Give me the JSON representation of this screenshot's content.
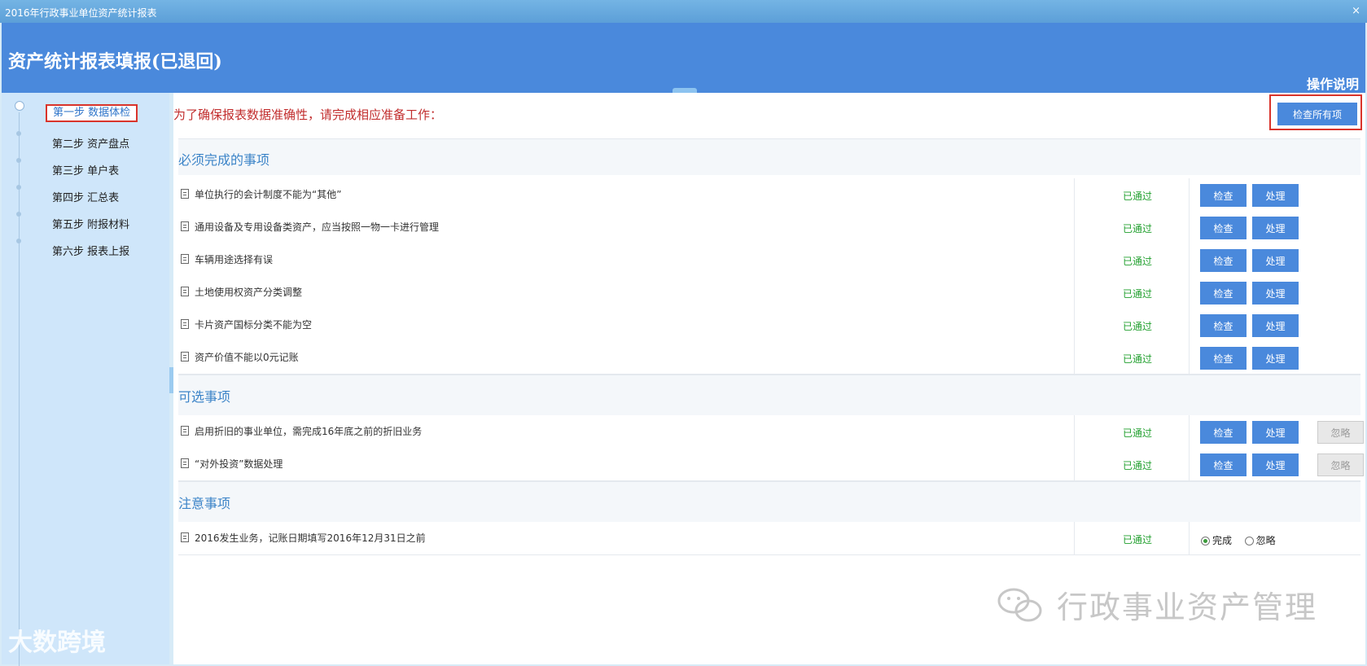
{
  "window": {
    "title": "2016年行政事业单位资产统计报表",
    "close": "×"
  },
  "header": {
    "title": "资产统计报表填报(已退回)",
    "help": "操作说明"
  },
  "steps": [
    "第一步 数据体检",
    "第二步 资产盘点",
    "第三步 单户表",
    "第四步 汇总表",
    "第五步 附报材料",
    "第六步 报表上报"
  ],
  "intro": "为了确保报表数据准确性，请完成相应准备工作：",
  "check_all": "检查所有项",
  "sections": {
    "required": {
      "title": "必须完成的事项",
      "items": [
        {
          "label": "单位执行的会计制度不能为“其他”",
          "status": "已通过"
        },
        {
          "label": "通用设备及专用设备类资产，应当按照一物一卡进行管理",
          "status": "已通过"
        },
        {
          "label": "车辆用途选择有误",
          "status": "已通过"
        },
        {
          "label": "土地使用权资产分类调整",
          "status": "已通过"
        },
        {
          "label": "卡片资产国标分类不能为空",
          "status": "已通过"
        },
        {
          "label": "资产价值不能以0元记账",
          "status": "已通过"
        }
      ]
    },
    "optional": {
      "title": "可选事项",
      "items": [
        {
          "label": "启用折旧的事业单位，需完成16年底之前的折旧业务",
          "status": "已通过"
        },
        {
          "label": "“对外投资”数据处理",
          "status": "已通过"
        }
      ]
    },
    "notes": {
      "title": "注意事项",
      "items": [
        {
          "label": "2016发生业务，记账日期填写2016年12月31日之前",
          "status": "已通过"
        }
      ]
    }
  },
  "buttons": {
    "check": "检查",
    "handle": "处理",
    "ignore": "忽略"
  },
  "radio": {
    "done": "完成",
    "ignore": "忽略",
    "selected": "完成"
  },
  "watermark": {
    "text": "行政事业资产管理",
    "logo": "大数跨境"
  },
  "colors": {
    "accent": "#4a89dc",
    "pass": "#22a02f",
    "highlight": "#d9342b"
  }
}
